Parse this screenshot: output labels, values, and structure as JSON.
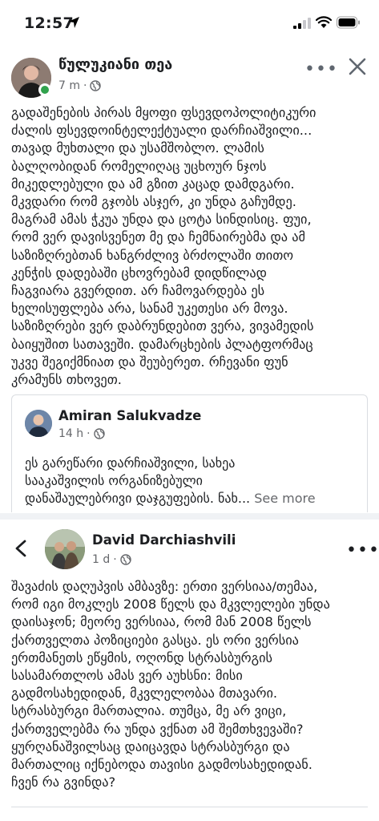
{
  "status_bar": {
    "time": "12:57",
    "icons": [
      "location-arrow-icon",
      "signal-icon",
      "wifi-icon",
      "battery-icon"
    ]
  },
  "post": {
    "author": "წულუკიანი თეა",
    "time": "7 m",
    "dot": "·",
    "privacy_icon": "globe-icon",
    "more_label": "•••",
    "body": "გადაშენების პირას მყოფი ფსევდოპოლიტიკური\nძალის ფსევდოინტელექტუალი დარჩიაშვილი...\nთავად მუხთალი და უსამშობლო. ლამის\nბალღობიდან რომელიღაც უცხოურ ნჯოს\nმიკედლებული და ამ გზით კაცად დამდგარი.\nმკვდარი რომ გჯობს ასჯერ, კი უნდა გაჩუმდე.\nმაგრამ ამას ჭკუა უნდა და ცოტა სინდისიც. ფუი,\nრომ ვერ დავისვენეთ მე და ჩემნაირებმა და ამ\nსაზიზღრებთან ხანგრძლივ ბრძოლაში თითო\nკენჭის დადებაში ცხოვრებამ დიდწილად\nჩაგვიარა გვერდით. არ ჩამოვარდება ეს\nხელისუფლება არა, სანამ უკეთესი არ მოვა.\nსაზიზღრები ვერ დაბრუნდებით ვერა, ვივამედის\nბაიყუშით სათავეში. დამარცხების პლატფორმაც\nუკვე შეგიქმნიათ და შეუბერეთ. რჩევანი ფუნ\nკრამუნს თხოვეთ."
  },
  "shared_post": {
    "author": "Amiran Salukvadze",
    "time": "14 h",
    "dot": "·",
    "body": "ეს გარეწარი დარჩიაშვილი, სახეა\nსააკაშვილის ორგანიზებული\nდანაშაულებრივი დაჯგუფების. ნახ...",
    "see_more": " See more"
  },
  "second_post": {
    "author": "David Darchiashvili",
    "time": "1 d",
    "dot": "·",
    "more_label": "•••",
    "body": "შავაძის დაღუპვის ამბავზე: ერთი ვერსიაა/თემაა,\nრომ იგი მოკლეს 2008 წელს და მკვლელები უნდა\nდაისაჯონ; მეორე ვერსიაა, რომ მან 2008 წელს\nქართველთა პოზიციები გასცა. ეს ორი ვერსია\nერთმანეთს ეწყმის, ოღონდ სტრასბურგის\nსასამართლოს ამას ვერ აუხსნი: მისი\nგადმოსახედიდან, მკვლელობაა მთავარი.\nსტრასბურგი მართალია. თუმცა, მე არ ვიცი,\nქართველებმა რა უნდა ვქნათ ამ შემთხვევაში?\nყურღანაშვილსაც დაიცავდა სტრასბურგი და\nმართალიც იქნებოდა თავისი გადმოსახედიდან.\nჩვენ რა გვინდა?"
  }
}
